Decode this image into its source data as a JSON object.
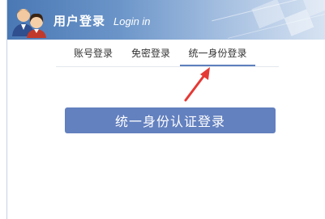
{
  "header": {
    "title": "用户登录",
    "subtitle": "Login in"
  },
  "tabs": [
    {
      "label": "账号登录",
      "active": false
    },
    {
      "label": "免密登录",
      "active": false
    },
    {
      "label": "统一身份登录",
      "active": true
    }
  ],
  "main": {
    "auth_button_label": "统一身份认证登录"
  },
  "colors": {
    "header_start": "#4a78b4",
    "active_tab_underline": "#5d7fbd",
    "button_background": "#6380bf",
    "annotation_arrow": "#e53935"
  },
  "icons": [
    "users-icon",
    "annotation-arrow"
  ]
}
